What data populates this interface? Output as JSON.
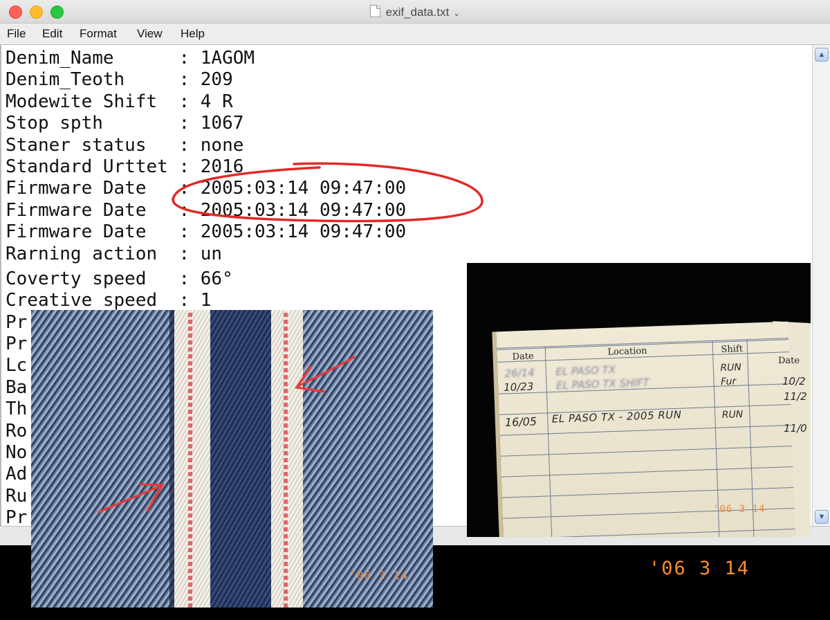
{
  "window": {
    "title": "exif_data.txt",
    "traffic_lights": [
      "close",
      "minimize",
      "zoom"
    ]
  },
  "menubar": [
    "File",
    "Edit",
    "Format",
    "View",
    "Help"
  ],
  "editor": {
    "lines": [
      "Denim_Name      : 1AGOM",
      "Denim_Teoth     : 209",
      "Modewite Shift  : 4 R",
      "Stop spth       : 1067",
      "Staner status   : none",
      "Standard Urttet : 2016",
      "Firmware Date   : 2005:03:14 09:47:00",
      "Firmware Date   : 2005:03:14 09:47:00",
      "Firmware Date   : 2005:03:14 09:47:00",
      "Rarning action  : un",
      "Coverty speed   : 66°",
      "Creative speed  : 1",
      "Pr",
      "Pr",
      "Lc",
      "Ba",
      "Th",
      "Ro",
      "No",
      "Ad",
      "Ru",
      "Pr"
    ]
  },
  "photos": {
    "denim": {
      "date_stamp": "'06 3 14"
    },
    "logbook": {
      "headers": [
        "Date",
        "Location",
        "Shift",
        "Date"
      ],
      "rows": [
        {
          "date": "26/14",
          "location": "EL PASO TX",
          "shift": "RUN"
        },
        {
          "date": "10/23",
          "location": "EL PASO TX SHIFT",
          "shift": "Fur"
        },
        {
          "date": "16/05",
          "location": "EL PASO TX - 2005 RUN",
          "shift": "RUN"
        }
      ],
      "side_dates": [
        "10/2",
        "11/2",
        "11/0"
      ],
      "date_stamp": "'06 3 14"
    }
  },
  "bottom_date_stamp": "'06 3 14",
  "colors": {
    "annotation": "#e02a26",
    "date_stamp": "#f08a3c"
  }
}
